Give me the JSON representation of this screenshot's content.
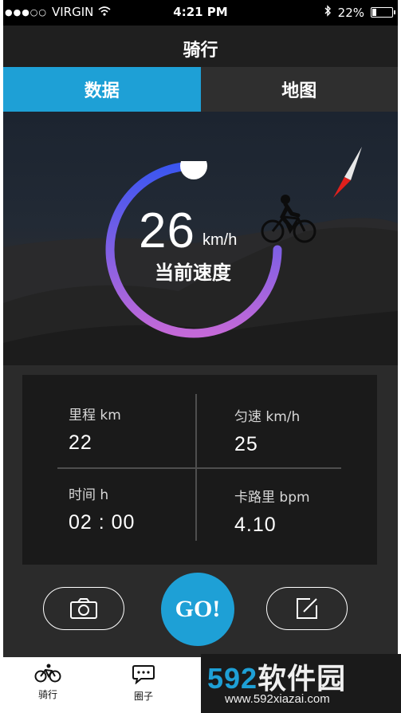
{
  "status_bar": {
    "carrier": "VIRGIN",
    "signal_dots": "●●●○○",
    "time": "4:21 PM",
    "battery_percent": "22%",
    "battery_level": 0.22
  },
  "nav": {
    "title": "骑行"
  },
  "tabs": [
    {
      "label": "数据",
      "active": true
    },
    {
      "label": "地图",
      "active": false
    }
  ],
  "gauge": {
    "speed_value": "26",
    "speed_unit": "km/h",
    "speed_label": "当前速度",
    "gradient_start": "#3b56f0",
    "gradient_end": "#c469d8"
  },
  "stats": {
    "mileage": {
      "label": "里程 km",
      "value": "22"
    },
    "avg_speed": {
      "label": "匀速 km/h",
      "value": "25"
    },
    "time": {
      "label": "时间 h",
      "value": "02 : 00"
    },
    "calories": {
      "label": "卡路里 bpm",
      "value": "4.10"
    }
  },
  "actions": {
    "camera_icon": "camera-icon",
    "go_label": "GO!",
    "edit_icon": "edit-icon"
  },
  "tab_bar": {
    "items": [
      {
        "label": "骑行",
        "icon": "bicycle-icon"
      },
      {
        "label": "圈子",
        "icon": "chat-icon"
      }
    ]
  },
  "watermark": {
    "number": "592",
    "text": "软件园",
    "url": "www.592xiazai.com"
  },
  "colors": {
    "accent": "#1ea0d6",
    "compass_red": "#e0201c"
  }
}
